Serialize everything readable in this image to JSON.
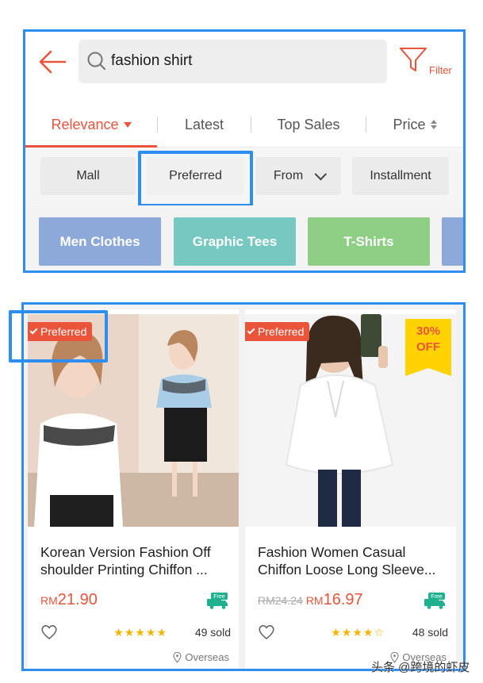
{
  "search": {
    "back_icon": "arrow-left-icon",
    "query": "fashion shirt",
    "filter_label": "Filter"
  },
  "sort_tabs": [
    {
      "label": "Relevance",
      "active": true
    },
    {
      "label": "Latest"
    },
    {
      "label": "Top Sales"
    },
    {
      "label": "Price"
    }
  ],
  "filters": {
    "mall": "Mall",
    "preferred": "Preferred",
    "from": "From",
    "installment": "Installment"
  },
  "categories": [
    {
      "label": "Men Clothes",
      "color": "#8da9d9"
    },
    {
      "label": "Graphic Tees",
      "color": "#77c8c0"
    },
    {
      "label": "T-Shirts",
      "color": "#8fcf85"
    }
  ],
  "products": [
    {
      "badge": "Preferred",
      "title_line1": "Korean Version Fashion Off",
      "title_line2": "shoulder Printing Chiffon ...",
      "currency": "RM",
      "price": "21.90",
      "old_price": "",
      "free_shipping": "Free",
      "rating": 4.5,
      "stars": "★★★★★",
      "sold": "49 sold",
      "location": "Overseas"
    },
    {
      "badge": "Preferred",
      "discount_percent": "30%",
      "discount_label": "OFF",
      "title_line1": "Fashion Women Casual",
      "title_line2": "Chiffon Loose Long Sleeve...",
      "currency": "RM",
      "price": "16.97",
      "old_price": "RM24.24",
      "free_shipping": "Free",
      "rating": 4.5,
      "stars": "★★★★☆",
      "sold": "48 sold",
      "location": "Overseas"
    }
  ],
  "watermark": "头条 @跨境的虾皮",
  "colors": {
    "accent": "#e9543a",
    "highlight": "#2d8ef0",
    "star": "#f5b400"
  }
}
